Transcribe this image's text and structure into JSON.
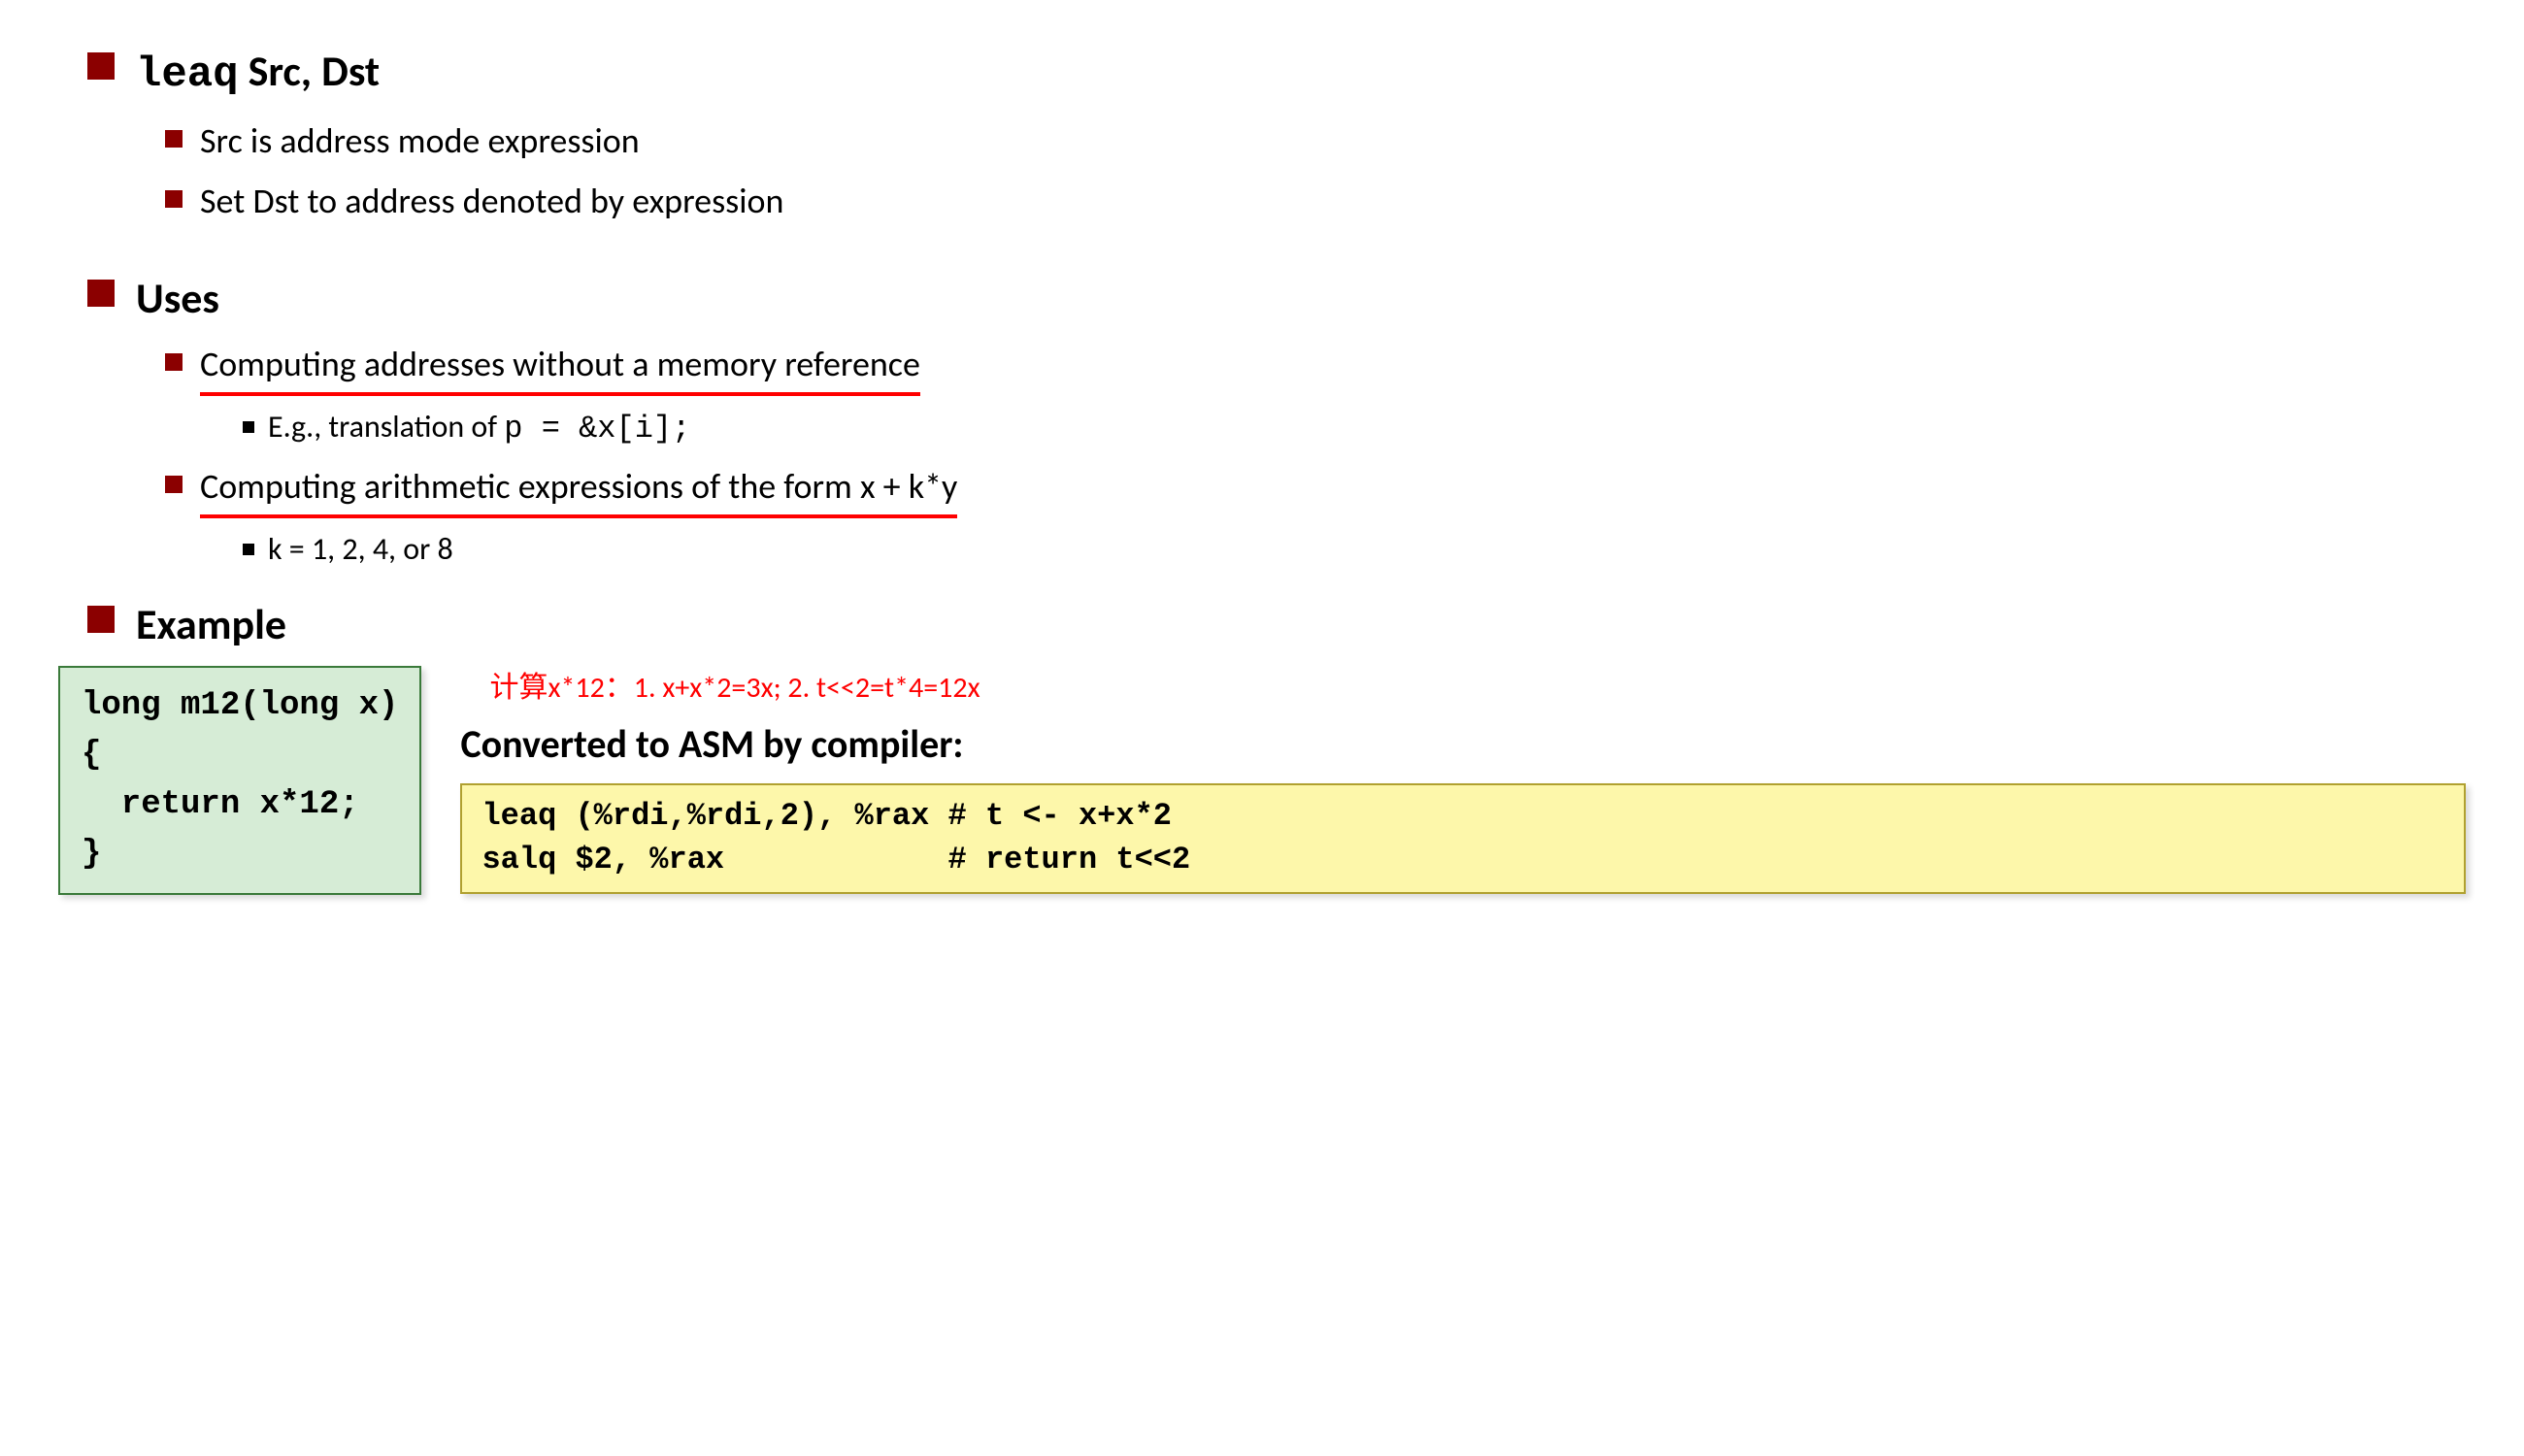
{
  "section1": {
    "heading_mono": "leaq",
    "heading_rest": " Src, Dst",
    "items": [
      "Src is address mode expression",
      "Set Dst to address denoted by expression"
    ]
  },
  "section2": {
    "heading": "Uses",
    "item1": "Computing addresses without a memory reference",
    "item1_sub_prefix": "E.g., translation of ",
    "item1_sub_code": "p = &x[i];",
    "item2": "Computing arithmetic expressions of the form x + k*y",
    "item2_sub": "k = 1, 2, 4, or 8"
  },
  "section3": {
    "heading": "Example",
    "code_c": "long m12(long x)\n{\n  return x*12;\n}",
    "annotation": "计算x*12：1. x+x*2=3x; 2. t<<2=t*4=12x",
    "asm_title": "Converted to ASM by compiler:",
    "code_asm": "leaq (%rdi,%rdi,2), %rax # t <- x+x*2\nsalq $2, %rax            # return t<<2"
  }
}
